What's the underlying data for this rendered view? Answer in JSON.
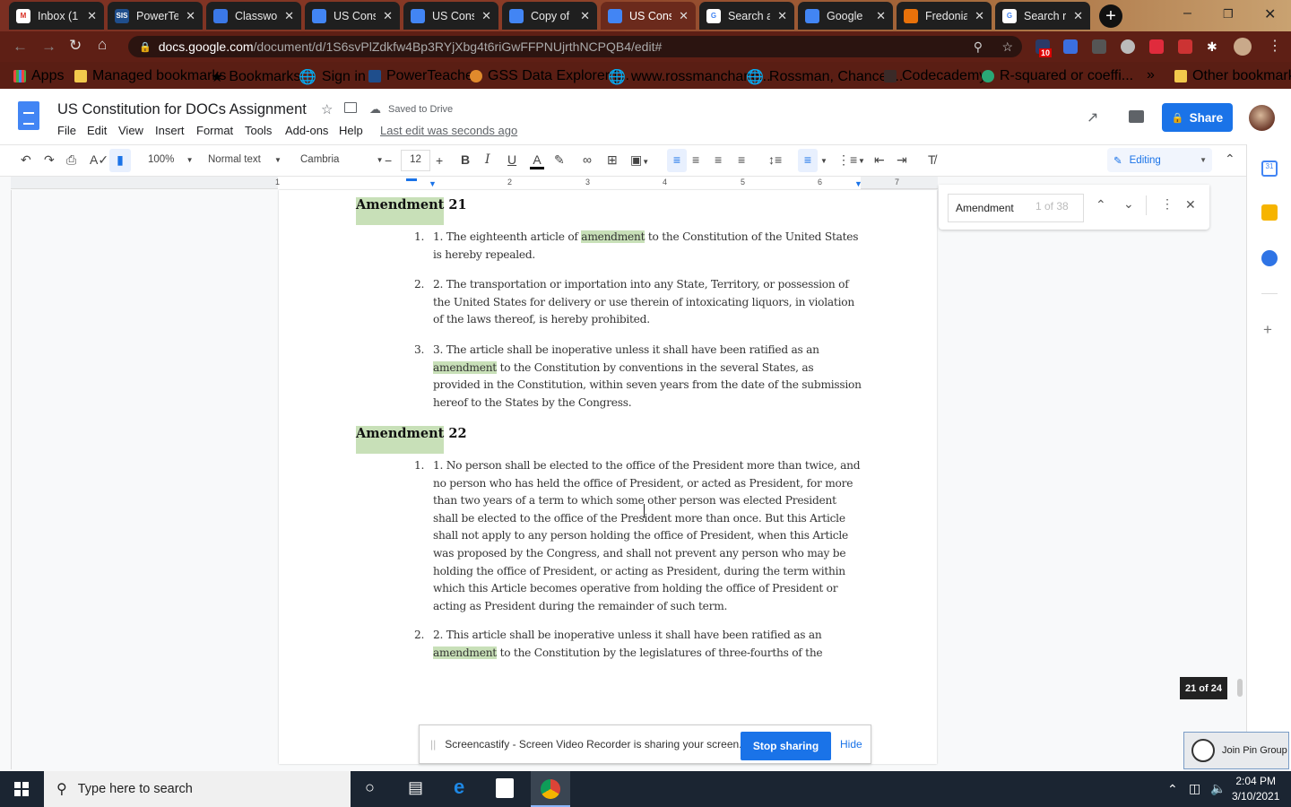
{
  "browser": {
    "tabs": [
      {
        "label": "Inbox (1",
        "icon": "gmail-icon",
        "active": false
      },
      {
        "label": "PowerTe",
        "icon": "sis-icon",
        "active": false
      },
      {
        "label": "Classwo",
        "icon": "classroom-icon",
        "active": false
      },
      {
        "label": "US Cons",
        "icon": "docs-icon",
        "active": false
      },
      {
        "label": "US Cons",
        "icon": "docs-icon",
        "active": false
      },
      {
        "label": "Copy of",
        "icon": "docs-icon",
        "active": false
      },
      {
        "label": "US Cons",
        "icon": "docs-icon",
        "active": true
      },
      {
        "label": "Search a",
        "icon": "google-icon",
        "active": false
      },
      {
        "label": "Google",
        "icon": "docs-icon",
        "active": false
      },
      {
        "label": "Fredonia",
        "icon": "slides-icon",
        "active": false
      },
      {
        "label": "Search r",
        "icon": "google-icon",
        "active": false
      }
    ],
    "url_host": "docs.google.com",
    "url_path": "/document/d/1S6svPlZdkfw4Bp3RYjXbg4t6riGwFFPNUjrthNCPQB4/edit#",
    "extension_badge": "10",
    "bookmarks": [
      {
        "label": "Apps"
      },
      {
        "label": "Managed bookmarks"
      },
      {
        "label": "Bookmarks"
      },
      {
        "label": "Sign in"
      },
      {
        "label": "PowerTeacher"
      },
      {
        "label": "GSS Data Explorer |..."
      },
      {
        "label": "www.rossmanchanc..."
      },
      {
        "label": "Rossman, Chance:..."
      },
      {
        "label": "Codecademy"
      },
      {
        "label": "R-squared or coeffi..."
      }
    ],
    "more_bookmarks": "»",
    "other_bookmarks": "Other bookmarks"
  },
  "docs": {
    "title": "US Constitution for DOCs Assignment",
    "saved_status": "Saved to Drive",
    "menu": [
      "File",
      "Edit",
      "View",
      "Insert",
      "Format",
      "Tools",
      "Add-ons",
      "Help"
    ],
    "last_edit": "Last edit was seconds ago",
    "share_label": "Share",
    "toolbar": {
      "zoom": "100%",
      "style": "Normal text",
      "font": "Cambria",
      "font_size": "12",
      "mode": "Editing"
    },
    "ruler_marks": [
      "1",
      "1",
      "2",
      "3",
      "4",
      "5",
      "6",
      "7"
    ]
  },
  "document": {
    "sections": [
      {
        "heading_match": "Amendment",
        "heading_rest": " 21",
        "items": [
          {
            "num": "1.",
            "parts": [
              "1. The eighteenth article of ",
              "amendment",
              " to the Constitution of the United States is hereby repealed."
            ]
          },
          {
            "num": "2.",
            "parts": [
              "2. The transportation or importation into any State, Territory, or possession of the United States for delivery or use therein of intoxicating liquors, in violation of the laws thereof, is hereby prohibited.",
              "",
              ""
            ]
          },
          {
            "num": "3.",
            "parts": [
              "3. The article shall be inoperative unless it shall have been ratified as an ",
              "amendment",
              " to the Constitution by conventions in the several States, as provided in the Constitution, within seven years from the date of the submission hereof to the States by the Congress."
            ]
          }
        ]
      },
      {
        "heading_match": "Amendment",
        "heading_rest": " 22",
        "items": [
          {
            "num": "1.",
            "parts": [
              "1. No person shall be elected to the office of the President more than twice, and no person who has held the office of President, or acted as President, for more than two years of a term to which some other person was elected President shall be elected to the office of the President more than once. But this Article shall not apply to any person holding the office of President, when this Article was proposed by the Congress, and shall not prevent any person who may be holding the office of President, or acting as President, during the term within which this Article becomes operative from holding the office of President or acting as President during the remainder of such term.",
              "",
              ""
            ]
          },
          {
            "num": "2.",
            "parts": [
              "2. This article shall be inoperative unless it shall have been ratified as an ",
              "amendment",
              " to the Constitution by the legislatures of three-fourths of the"
            ]
          }
        ]
      }
    ]
  },
  "find": {
    "query": "Amendment",
    "count": "1 of 38"
  },
  "page_indicator": "21 of 24",
  "screencastify": {
    "message": "Screencastify - Screen Video Recorder is sharing your screen.",
    "stop_label": "Stop sharing",
    "hide_label": "Hide"
  },
  "pin_group": "Join Pin Group",
  "taskbar": {
    "search_placeholder": "Type here to search",
    "time": "2:04 PM",
    "date": "3/10/2021"
  },
  "colors": {
    "accent": "#1a73e8",
    "highlight": "#c8e0b8"
  }
}
